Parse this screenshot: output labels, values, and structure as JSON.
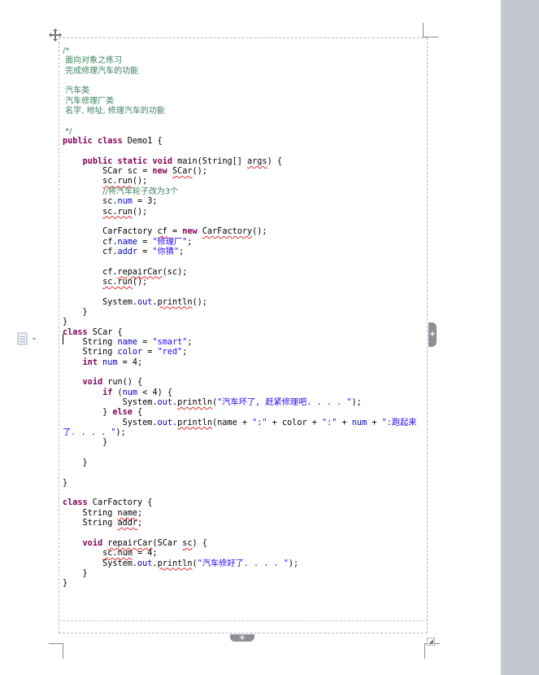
{
  "editor": {
    "code_lines": [
      [
        {
          "t": "/*",
          "c": "c"
        }
      ],
      [
        {
          "t": " 面向对象之练习",
          "c": "c"
        }
      ],
      [
        {
          "t": " 完成修理汽车的功能",
          "c": "c"
        }
      ],
      [],
      [
        {
          "t": " 汽车类",
          "c": "c"
        }
      ],
      [
        {
          "t": " 汽车修理厂类",
          "c": "c"
        }
      ],
      [
        {
          "t": " 名字, 地址, 修理汽车的功能",
          "c": "c"
        }
      ],
      [],
      [
        {
          "t": " */",
          "c": "c"
        }
      ],
      [
        {
          "t": "public",
          "c": "k"
        },
        {
          "t": " "
        },
        {
          "t": "class",
          "c": "k"
        },
        {
          "t": " Demo1 {"
        }
      ],
      [],
      [
        {
          "t": "    "
        },
        {
          "t": "public",
          "c": "k"
        },
        {
          "t": " "
        },
        {
          "t": "static",
          "c": "k"
        },
        {
          "t": " "
        },
        {
          "t": "void",
          "c": "k"
        },
        {
          "t": " main(String[] "
        },
        {
          "t": "args",
          "c": "sq"
        },
        {
          "t": ") {"
        }
      ],
      [
        {
          "t": "        SCar sc = "
        },
        {
          "t": "new",
          "c": "k"
        },
        {
          "t": " "
        },
        {
          "t": "SCar",
          "c": "sq"
        },
        {
          "t": "();"
        }
      ],
      [
        {
          "t": "        "
        },
        {
          "t": "sc.run",
          "c": "sq"
        },
        {
          "t": "();"
        }
      ],
      [
        {
          "t": "        "
        },
        {
          "t": "//将汽车轮子改为3个",
          "c": "c"
        }
      ],
      [
        {
          "t": "        sc."
        },
        {
          "t": "num",
          "c": "f"
        },
        {
          "t": " = 3;"
        }
      ],
      [
        {
          "t": "        "
        },
        {
          "t": "sc.run",
          "c": "sq"
        },
        {
          "t": "();"
        }
      ],
      [],
      [
        {
          "t": "        CarFactory "
        },
        {
          "t": "cf",
          "c": "sq"
        },
        {
          "t": " = "
        },
        {
          "t": "new",
          "c": "k"
        },
        {
          "t": " "
        },
        {
          "t": "CarFactory",
          "c": "sq"
        },
        {
          "t": "();"
        }
      ],
      [
        {
          "t": "        cf."
        },
        {
          "t": "name",
          "c": "f"
        },
        {
          "t": " = "
        },
        {
          "t": "\"修理厂\"",
          "c": "s"
        },
        {
          "t": ";"
        }
      ],
      [
        {
          "t": "        cf."
        },
        {
          "t": "addr",
          "c": "f"
        },
        {
          "t": " = "
        },
        {
          "t": "\"你猜\"",
          "c": "s"
        },
        {
          "t": ";"
        }
      ],
      [],
      [
        {
          "t": "        cf."
        },
        {
          "t": "repairCar",
          "c": "sq"
        },
        {
          "t": "(sc);"
        }
      ],
      [
        {
          "t": "        "
        },
        {
          "t": "sc.run",
          "c": "sq"
        },
        {
          "t": "();"
        }
      ],
      [],
      [
        {
          "t": "        System."
        },
        {
          "t": "out",
          "c": "f"
        },
        {
          "t": "."
        },
        {
          "t": "println",
          "c": "sq"
        },
        {
          "t": "();"
        }
      ],
      [
        {
          "t": "    }"
        }
      ],
      [
        {
          "t": "}"
        }
      ],
      [
        {
          "t": "class",
          "c": "k"
        },
        {
          "t": " SCar {"
        }
      ],
      [
        {
          "t": "    String "
        },
        {
          "t": "name",
          "c": "f"
        },
        {
          "t": " = "
        },
        {
          "t": "\"smart\"",
          "c": "s"
        },
        {
          "t": ";"
        }
      ],
      [
        {
          "t": "    String "
        },
        {
          "t": "color",
          "c": "f"
        },
        {
          "t": " = "
        },
        {
          "t": "\"red\"",
          "c": "s"
        },
        {
          "t": ";"
        }
      ],
      [
        {
          "t": "    "
        },
        {
          "t": "int",
          "c": "k"
        },
        {
          "t": " "
        },
        {
          "t": "num",
          "c": "f"
        },
        {
          "t": " = 4;"
        }
      ],
      [],
      [
        {
          "t": "    "
        },
        {
          "t": "void",
          "c": "k"
        },
        {
          "t": " run() {"
        }
      ],
      [
        {
          "t": "        "
        },
        {
          "t": "if",
          "c": "k"
        },
        {
          "t": " ("
        },
        {
          "t": "num",
          "c": "f"
        },
        {
          "t": " < 4) {"
        }
      ],
      [
        {
          "t": "            System."
        },
        {
          "t": "out",
          "c": "f"
        },
        {
          "t": "."
        },
        {
          "t": "println",
          "c": "sq"
        },
        {
          "t": "("
        },
        {
          "t": "\"汽车坏了, 赶紧修理吧. . . . \"",
          "c": "s"
        },
        {
          "t": ");"
        }
      ],
      [
        {
          "t": "        } "
        },
        {
          "t": "else",
          "c": "k"
        },
        {
          "t": " {"
        }
      ],
      [
        {
          "t": "            System."
        },
        {
          "t": "out",
          "c": "f"
        },
        {
          "t": "."
        },
        {
          "t": "println",
          "c": "sq"
        },
        {
          "t": "(name + "
        },
        {
          "t": "\":\"",
          "c": "s"
        },
        {
          "t": " + color + "
        },
        {
          "t": "\":\"",
          "c": "s"
        },
        {
          "t": " + "
        },
        {
          "t": "num",
          "c": "f"
        },
        {
          "t": " + "
        },
        {
          "t": "\":跑起来",
          "c": "s"
        }
      ],
      [
        {
          "t": "了. . . . \"",
          "c": "s"
        },
        {
          "t": ");"
        }
      ],
      [
        {
          "t": "        }"
        }
      ],
      [],
      [
        {
          "t": "    }"
        }
      ],
      [],
      [
        {
          "t": "}"
        }
      ],
      [],
      [
        {
          "t": "class",
          "c": "k"
        },
        {
          "t": " CarFactory {"
        }
      ],
      [
        {
          "t": "    String "
        },
        {
          "t": "name",
          "c": "sq"
        },
        {
          "t": ";"
        }
      ],
      [
        {
          "t": "    String "
        },
        {
          "t": "addr",
          "c": "sq"
        },
        {
          "t": ";"
        }
      ],
      [],
      [
        {
          "t": "    "
        },
        {
          "t": "void",
          "c": "k"
        },
        {
          "t": " "
        },
        {
          "t": "repairCar",
          "c": "sq"
        },
        {
          "t": "(SCar "
        },
        {
          "t": "sc",
          "c": "sq"
        },
        {
          "t": ") {"
        }
      ],
      [
        {
          "t": "        "
        },
        {
          "t": "sc.num",
          "c": "sq"
        },
        {
          "t": " = 4;"
        }
      ],
      [
        {
          "t": "        System."
        },
        {
          "t": "out",
          "c": "f"
        },
        {
          "t": "."
        },
        {
          "t": "println",
          "c": "sq"
        },
        {
          "t": "("
        },
        {
          "t": "\"汽车修好了. . . . \"",
          "c": "s"
        },
        {
          "t": ");"
        }
      ],
      [
        {
          "t": "    }"
        }
      ],
      [
        {
          "t": "}"
        }
      ]
    ]
  },
  "icons": {
    "move_handle": "table-move-icon",
    "add_row": "add-row-icon",
    "add_column": "add-column-icon",
    "layout_options": "layout-options-icon",
    "resize_handle": "table-resize-icon"
  },
  "controls": {
    "add_row_glyph": "+",
    "add_column_glyph": "+"
  },
  "colors": {
    "comment": "#3f7f5f",
    "keyword": "#7f0055",
    "string": "#2a00ff",
    "field": "#0000c0",
    "spellcheck_underline": "#e03030",
    "gutter": "#c4c7cf"
  }
}
